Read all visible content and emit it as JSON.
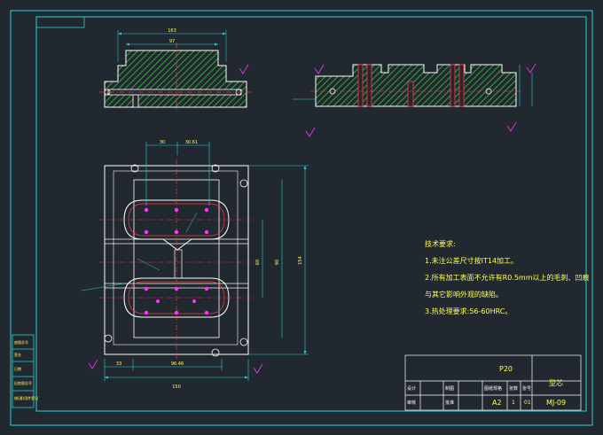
{
  "drawing": {
    "background": "#212830",
    "frame_color": "#2bd0d0",
    "outline_color": "#ffffff",
    "hatch_color": "#3ec23e",
    "centerline_color": "#ff3b3b",
    "dimension_color": "#2bd0d0",
    "marker_color": "#ff33ff",
    "text_color": "#ffff55"
  },
  "dimensions": {
    "top_overall": "163",
    "top_inner": "97",
    "plan_offset_a": "30",
    "plan_offset_b": "30.61",
    "plan_bottom_a": "33",
    "plan_bottom_b": "96.46",
    "plan_bottom_overall": "150",
    "plan_height_inner": "60",
    "plan_height_mid": "90",
    "plan_height_overall": "154"
  },
  "technical_requirements": {
    "title": "技术要求:",
    "items": [
      "1.未注公差尺寸按IT14加工。",
      "2.所有加工表面不允许有R0.5mm以上的毛刺、凹痕",
      "与其它影响外观的缺陷。",
      "3.热处理要求:56-60HRC。"
    ]
  },
  "title_block": {
    "scale_ratio": "P20",
    "part_name": "型芯",
    "sheet_size": "A2",
    "sheet_count": "1",
    "sheet_number": "01",
    "drawing_number": "MJ-09",
    "row_label_design": "设计",
    "row_label_check": "审核",
    "label_drawn": "制图",
    "label_approved": "批准",
    "label_scale": "图纸规格",
    "label_sheets": "张数",
    "label_sheet_no": "张号"
  },
  "side_tabs": [
    "底图总号",
    "签名",
    "日期",
    "旧底图总号",
    "借(通)用件登记"
  ]
}
